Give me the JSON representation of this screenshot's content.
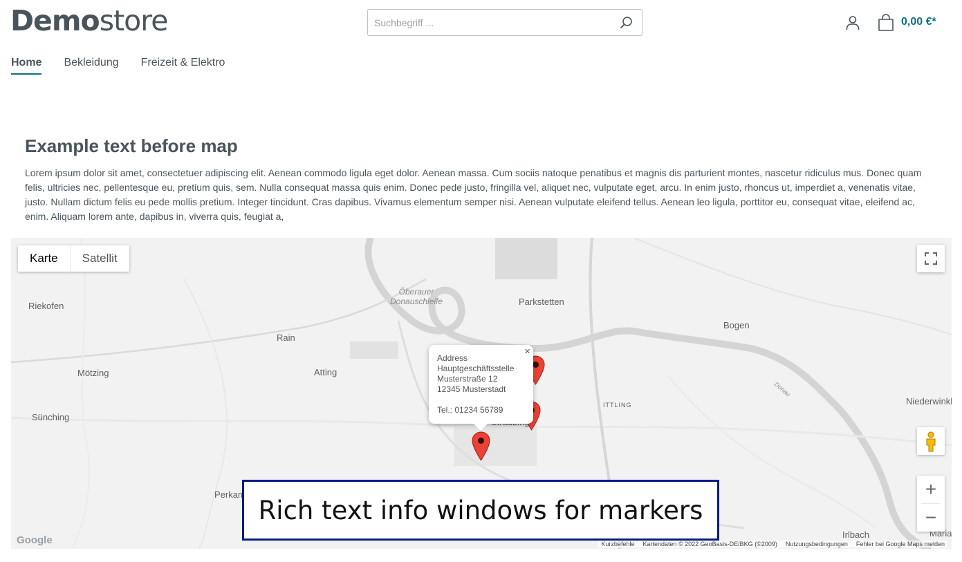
{
  "header": {
    "logo_bold": "Demo",
    "logo_light": "store",
    "search_placeholder": "Suchbegriff ...",
    "cart_total": "0,00 €*",
    "icons": [
      "search-icon",
      "account-icon",
      "cart-icon"
    ]
  },
  "nav": {
    "items": [
      {
        "label": "Home",
        "active": true
      },
      {
        "label": "Bekleidung",
        "active": false
      },
      {
        "label": "Freizeit & Elektro",
        "active": false
      }
    ]
  },
  "content": {
    "heading": "Example text before map",
    "paragraph": "Lorem ipsum dolor sit amet, consectetuer adipiscing elit. Aenean commodo ligula eget dolor. Aenean massa. Cum sociis natoque penatibus et magnis dis parturient montes, nascetur ridiculus mus. Donec quam felis, ultricies nec, pellentesque eu, pretium quis, sem. Nulla consequat massa quis enim. Donec pede justo, fringilla vel, aliquet nec, vulputate eget, arcu. In enim justo, rhoncus ut, imperdiet a, venenatis vitae, justo. Nullam dictum felis eu pede mollis pretium. Integer tincidunt. Cras dapibus. Vivamus elementum semper nisi. Aenean vulputate eleifend tellus. Aenean leo ligula, porttitor eu, consequat vitae, eleifend ac, enim. Aliquam lorem ante, dapibus in, viverra quis, feugiat a,"
  },
  "map": {
    "type_buttons": {
      "map": "Karte",
      "satellite": "Satellit"
    },
    "places": {
      "riekofen": "Riekofen",
      "moetzing": "Mötzing",
      "suenching": "Sünching",
      "rain": "Rain",
      "atting": "Atting",
      "parkstetten": "Parkstetten",
      "bogen": "Bogen",
      "niederwinkl": "Niederwinkl",
      "ittling": "ITTLING",
      "straubing": "Straubing",
      "perkam": "Perkam",
      "irlbach": "Irlbach",
      "maria": "Maria",
      "oberauer_line1": "Öberauer",
      "oberauer_line2": "Donauschleife",
      "donau": "Donau"
    },
    "info_window": {
      "title": "Address",
      "line1": "Hauptgeschäftsstelle",
      "line2": "Musterstraße 12",
      "line3": "12345 Musterstadt",
      "phone": "Tel.: 01234 56789",
      "close": "×"
    },
    "zoom_in": "+",
    "zoom_out": "−",
    "google": "Google",
    "attribution": {
      "shortcuts": "Kurzbefehle",
      "data": "Kartendaten © 2022 GeoBasis-DE/BKG (©2009)",
      "terms": "Nutzungsbedingungen",
      "report": "Fehler bei Google Maps melden"
    },
    "marker_color": "#ea4335"
  },
  "caption": "Rich text info windows for markers",
  "colors": {
    "accent": "#0b7285",
    "text": "#4a545b",
    "caption_border": "#0a1a82"
  }
}
